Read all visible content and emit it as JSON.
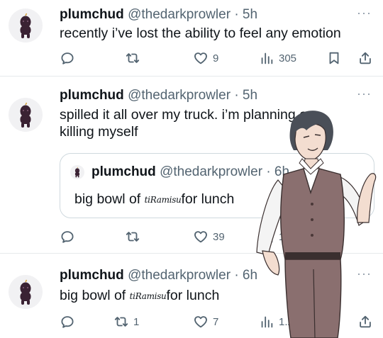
{
  "tweets": [
    {
      "name": "plumchud",
      "handle": "@thedarkprowler",
      "time": "· 5h",
      "more": "···",
      "text": "recently i’ve lost the ability to feel any emotion",
      "actions": {
        "reply": "",
        "retweet": "",
        "like": "9",
        "views": "305"
      }
    },
    {
      "name": "plumchud",
      "handle": "@thedarkprowler",
      "time": "· 5h",
      "more": "···",
      "text": "spilled it all over my truck. i’m planning on killing myself",
      "quote": {
        "name": "plumchud",
        "handle": "@thedarkprowler",
        "time": "· 6h",
        "text_before": "big bowl of ",
        "tiramisu": "tiRamisu",
        "text_after": "for lunch"
      },
      "actions": {
        "reply": "",
        "retweet": "",
        "like": "39",
        "views": "1K"
      }
    },
    {
      "name": "plumchud",
      "handle": "@thedarkprowler",
      "time": "· 6h",
      "more": "···",
      "text_before": "big bowl of ",
      "tiramisu": "tiRamisu",
      "text_after": "for lunch",
      "actions": {
        "reply": "",
        "retweet": "1",
        "like": "7",
        "views": "1.2K"
      }
    }
  ],
  "icons": {
    "reply": "reply-icon",
    "retweet": "retweet-icon",
    "like": "heart-icon",
    "views": "views-icon",
    "bookmark": "bookmark-icon",
    "share": "share-icon"
  },
  "colors": {
    "text": "#0f1419",
    "secondary": "#536471",
    "divider": "#e6e9ec",
    "avatar_figure": "#3a2233"
  }
}
